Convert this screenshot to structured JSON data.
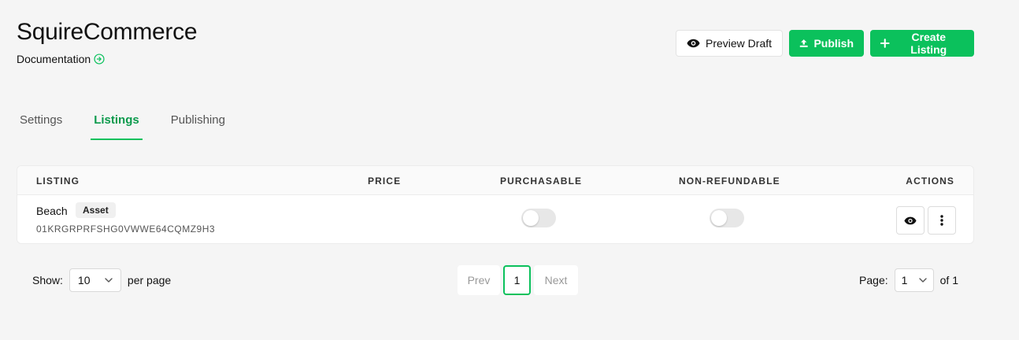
{
  "header": {
    "title": "SquireCommerce",
    "doc_link": "Documentation",
    "actions": {
      "preview": "Preview Draft",
      "publish": "Publish",
      "create": "Create Listing"
    }
  },
  "colors": {
    "accent": "#0bc15c",
    "accent_text": "#0b9a4c",
    "background": "#f5f5f5"
  },
  "tabs": [
    {
      "label": "Settings",
      "active": false
    },
    {
      "label": "Listings",
      "active": true
    },
    {
      "label": "Publishing",
      "active": false
    }
  ],
  "table": {
    "columns": [
      "Listing",
      "Price",
      "Purchasable",
      "Non-refundable",
      "Actions"
    ],
    "rows": [
      {
        "name": "Beach",
        "badge": "Asset",
        "id": "01KRGRPRFSHG0VWWE64CQMZ9H3",
        "price": "",
        "purchasable": false,
        "non_refundable": false
      }
    ]
  },
  "pagination": {
    "show_label": "Show:",
    "per_page_value": "10",
    "per_page_suffix": "per page",
    "prev": "Prev",
    "current": "1",
    "next": "Next",
    "page_label": "Page:",
    "page_value": "1",
    "of_label": "of 1"
  }
}
